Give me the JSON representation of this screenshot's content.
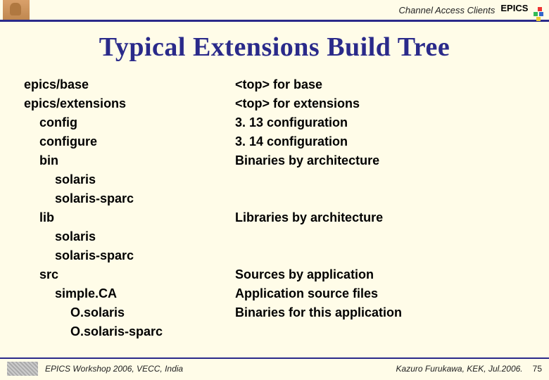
{
  "header": {
    "label": "Channel Access Clients",
    "logo_text": "EPICS"
  },
  "title": "Typical Extensions Build Tree",
  "tree": {
    "left": [
      {
        "t": "epics/base",
        "indent": 0
      },
      {
        "t": "epics/extensions",
        "indent": 0
      },
      {
        "t": "config",
        "indent": 1
      },
      {
        "t": "configure",
        "indent": 1
      },
      {
        "t": "bin",
        "indent": 1
      },
      {
        "t": "solaris",
        "indent": 2
      },
      {
        "t": "solaris-sparc",
        "indent": 2
      },
      {
        "t": "lib",
        "indent": 1
      },
      {
        "t": "solaris",
        "indent": 2
      },
      {
        "t": "solaris-sparc",
        "indent": 2
      },
      {
        "t": "src",
        "indent": 1
      },
      {
        "t": "simple.CA",
        "indent": 2
      },
      {
        "t": "O.solaris",
        "indent": 3
      },
      {
        "t": "O.solaris-sparc",
        "indent": 3
      }
    ],
    "right": [
      "<top> for base",
      "<top> for extensions",
      "3. 13 configuration",
      "3. 14 configuration",
      "Binaries by architecture",
      "",
      "",
      "Libraries by architecture",
      "",
      "",
      "Sources by application",
      "Application source files",
      "Binaries for this application",
      ""
    ]
  },
  "footer": {
    "left": "EPICS Workshop 2006, VECC, India",
    "right": "Kazuro Furukawa, KEK, Jul.2006.",
    "page": "75"
  }
}
